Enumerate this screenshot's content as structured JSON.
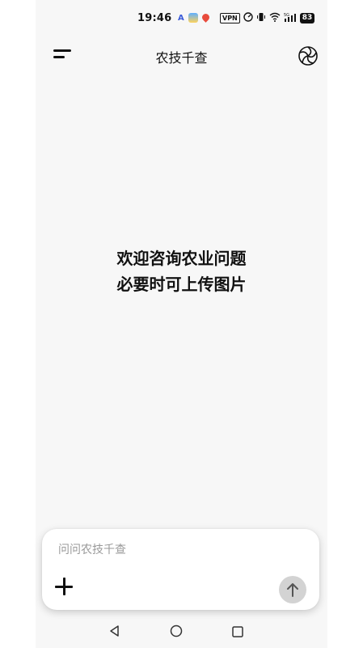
{
  "status_bar": {
    "time": "19:46",
    "vpn": "VPN",
    "battery": "83",
    "network": "5G",
    "icons": [
      "auto-a-icon",
      "weather-icon",
      "location-pin-icon",
      "vpn-icon",
      "speed-icon",
      "vibrate-icon",
      "wifi-icon",
      "signal-icon",
      "battery-icon"
    ]
  },
  "header": {
    "title": "农技千查",
    "menu_icon": "menu-icon",
    "logo_icon": "aperture-logo-icon"
  },
  "welcome": {
    "line1": "欢迎咨询农业问题",
    "line2": "必要时可上传图片"
  },
  "composer": {
    "placeholder": "问问农技千查",
    "value": "",
    "add_icon": "plus-icon",
    "send_icon": "arrow-up-icon"
  },
  "nav_bar": {
    "icons": [
      "back-triangle-icon",
      "home-circle-icon",
      "recents-square-icon"
    ]
  },
  "colors": {
    "background": "#f7f7f7",
    "card": "#ffffff",
    "send_button": "#d3d3d3",
    "text": "#111111",
    "placeholder": "#9a9a9a"
  }
}
